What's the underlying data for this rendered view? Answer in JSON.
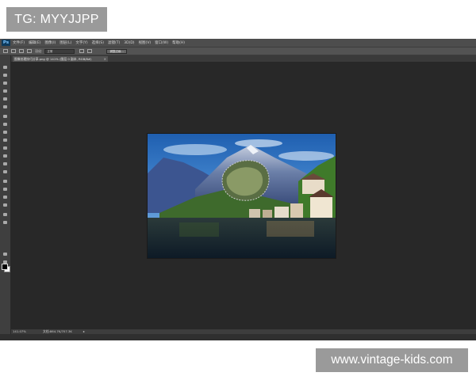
{
  "watermarks": {
    "top": "TG: MYYJJPP",
    "bottom": "www.vintage-kids.com"
  },
  "app": {
    "logo": "Ps",
    "menu": [
      "文件(F)",
      "编辑(E)",
      "图像(I)",
      "图层(L)",
      "文字(Y)",
      "选择(S)",
      "滤镜(T)",
      "3D(D)",
      "视图(V)",
      "窗口(W)",
      "帮助(H)"
    ],
    "options": {
      "feather_label": "羽化:",
      "style_select": "正常",
      "refine_button": "调整边缘..."
    },
    "document_tab": {
      "title": "图像处理技巧分享.png @ 141% (图层 0 副本, RGB/8#)",
      "close": "×"
    },
    "status": {
      "zoom": "141.07%",
      "doc_info": "文档:864.7K/707.3K",
      "arrow": "▸"
    },
    "tools": [
      "move-tool",
      "marquee-tool",
      "lasso-tool",
      "quick-select-tool",
      "crop-tool",
      "eyedropper-tool",
      "healing-tool",
      "brush-tool",
      "stamp-tool",
      "history-brush-tool",
      "eraser-tool",
      "gradient-tool",
      "blur-tool",
      "dodge-tool",
      "pen-tool",
      "type-tool",
      "path-select-tool",
      "shape-tool",
      "hand-tool",
      "zoom-tool"
    ],
    "colors": {
      "foreground": "#000000",
      "background": "#ffffff"
    }
  }
}
